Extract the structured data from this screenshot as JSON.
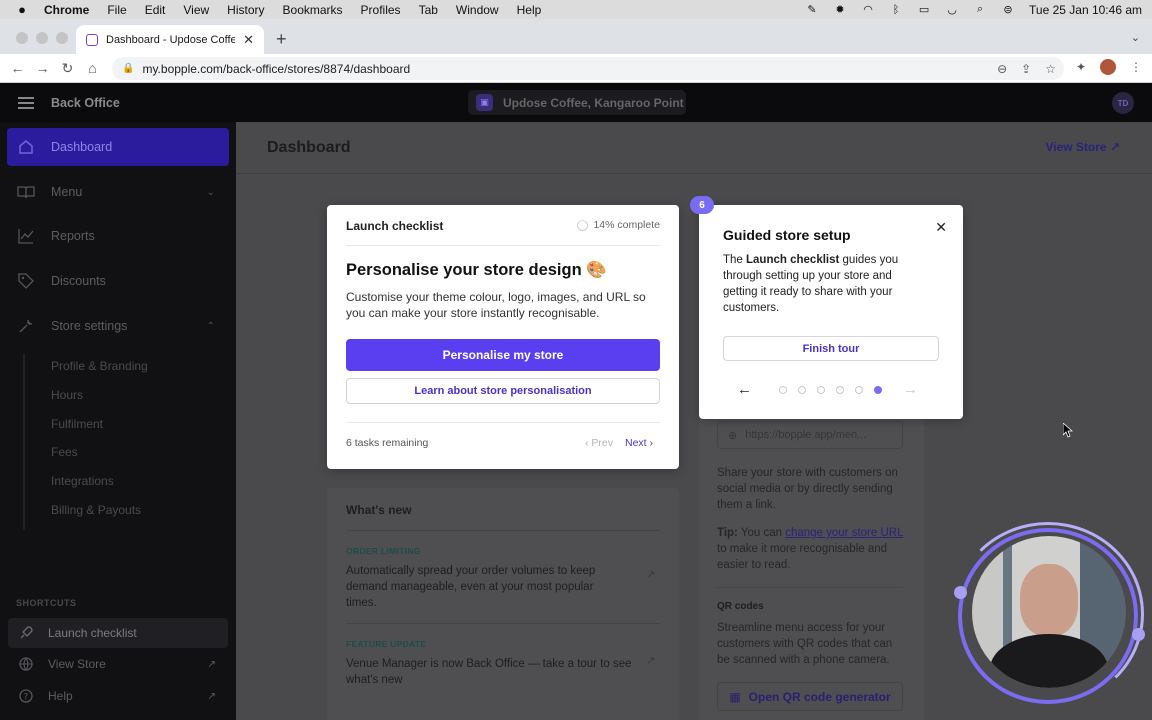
{
  "menubar": {
    "app": "Chrome",
    "items": [
      "File",
      "Edit",
      "View",
      "History",
      "Bookmarks",
      "Profiles",
      "Tab",
      "Window",
      "Help"
    ],
    "clock": "Tue 25 Jan  10:46 am"
  },
  "browser": {
    "tab_title": "Dashboard - Updose Coffee, K",
    "url": "my.bopple.com/back-office/stores/8874/dashboard"
  },
  "header": {
    "brand": "Back Office",
    "store_name": "Updose Coffee, Kangaroo Point",
    "avatar_initials": "TD"
  },
  "sidebar": {
    "items": [
      {
        "label": "Dashboard",
        "icon": "home-icon"
      },
      {
        "label": "Menu",
        "icon": "book-icon"
      },
      {
        "label": "Reports",
        "icon": "chart-icon"
      },
      {
        "label": "Discounts",
        "icon": "tag-icon"
      },
      {
        "label": "Store settings",
        "icon": "tools-icon"
      }
    ],
    "sub_items": [
      "Profile & Branding",
      "Hours",
      "Fulfilment",
      "Fees",
      "Integrations",
      "Billing & Payouts"
    ],
    "shortcuts_label": "SHORTCUTS",
    "shortcuts": [
      {
        "label": "Launch checklist"
      },
      {
        "label": "View Store"
      },
      {
        "label": "Help"
      }
    ]
  },
  "main": {
    "title": "Dashboard",
    "view_store": "View Store"
  },
  "checklist": {
    "heading": "Launch checklist",
    "progress": "14% complete",
    "progress_value": 14,
    "title": "Personalise your store design 🎨",
    "description": "Customise your theme colour, logo, images, and URL so you can make your store instantly recognisable.",
    "primary_button": "Personalise my store",
    "secondary_button": "Learn about store personalisation",
    "remaining": "6 tasks remaining",
    "prev": "Prev",
    "next": "Next"
  },
  "tour": {
    "step": "6",
    "title": "Guided store setup",
    "body_prefix": "The ",
    "body_bold": "Launch checklist",
    "body_suffix": " guides you through setting up your store and getting it ready to share with your customers.",
    "finish": "Finish tour",
    "total_steps": 6,
    "current_step": 6
  },
  "whats_new": {
    "title": "What's new",
    "items": [
      {
        "tag": "ORDER LIMITING",
        "text": "Automatically spread your order volumes to keep demand manageable, even at your most popular times."
      },
      {
        "tag": "FEATURE UPDATE",
        "text": "Venue Manager is now Back Office — take a tour to see what's new"
      }
    ]
  },
  "share": {
    "url_placeholder": "https://bopple.app/men...",
    "description": "Share your store with customers on social media or by directly sending them a link.",
    "tip_label": "Tip:",
    "tip_prefix": " You can ",
    "tip_link": "change your store URL",
    "tip_suffix": " to make it more recognisable and easier to read.",
    "qr_heading": "QR codes",
    "qr_description": "Streamline menu access for your customers with QR codes that can be scanned with a phone camera.",
    "qr_button": "Open QR code generator"
  }
}
